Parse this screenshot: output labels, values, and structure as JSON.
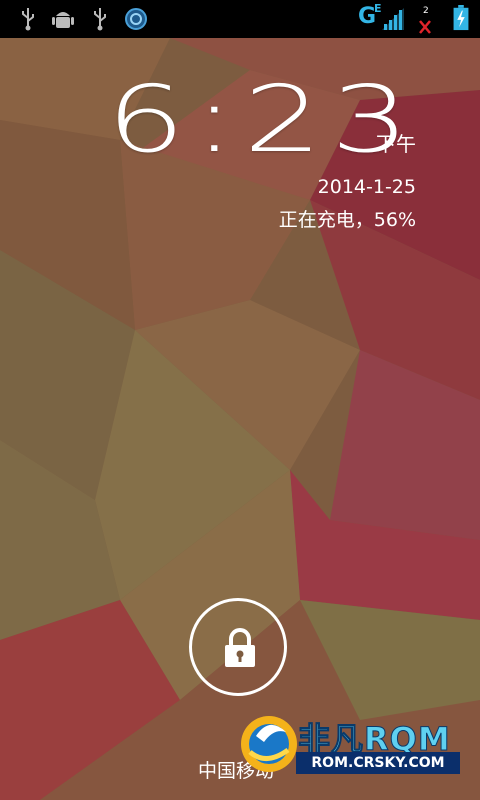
{
  "status_bar": {
    "network_label": "G",
    "network_sub": "E",
    "sim2_label": "2",
    "icons": [
      "usb-icon",
      "android-debug-icon",
      "usb-icon",
      "sync-icon",
      "signal-icon",
      "no-signal-icon",
      "battery-charging-icon"
    ]
  },
  "lockscreen": {
    "time": "6:23",
    "ampm": "下午",
    "date": "2014-1-25",
    "charging_status": "正在充电，56%",
    "carrier": "中国移动"
  },
  "watermark": {
    "brand": "非凡RQM",
    "url": "ROM.CRSKY.COM"
  },
  "colors": {
    "status_accent": "#33b5e5",
    "alert_red": "#e0242a"
  }
}
